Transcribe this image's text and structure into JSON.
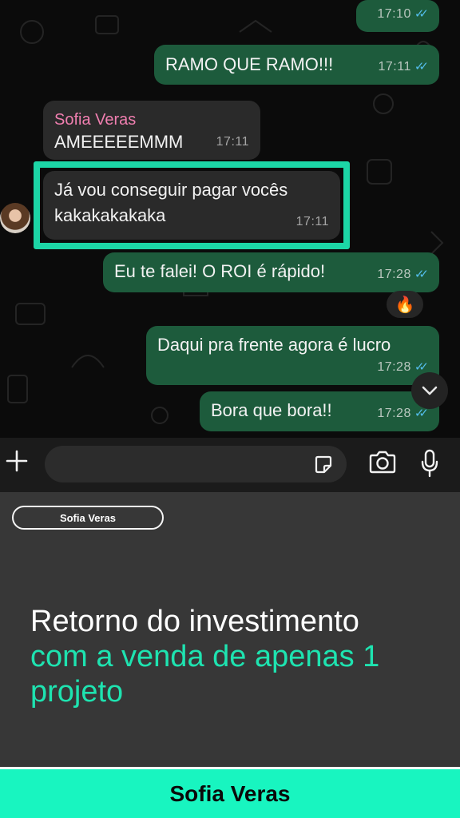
{
  "colors": {
    "outgoing_bubble": "#1d5b3c",
    "incoming_bubble": "#2a2a2a",
    "sender_name": "#f07fb0",
    "read_ticks": "#53bdeb",
    "highlight": "#1cd6a6",
    "accent": "#1ee3b0",
    "footer_bg": "#18f5c0"
  },
  "chat": {
    "messages": [
      {
        "direction": "out",
        "text": "",
        "time": "17:10",
        "read": true
      },
      {
        "direction": "out",
        "text": "RAMO QUE RAMO!!!",
        "time": "17:11",
        "read": true
      },
      {
        "direction": "in",
        "sender": "Sofia Veras",
        "text": "AMEEEEEMMM",
        "time": "17:11"
      },
      {
        "direction": "in",
        "text_line1": "Já vou conseguir pagar vocês",
        "text_line2": "kakakakakaka",
        "time": "17:11",
        "highlighted": true
      },
      {
        "direction": "out",
        "text": "Eu te falei! O ROI é rápido!",
        "time": "17:28",
        "read": true,
        "reaction": "🔥"
      },
      {
        "direction": "out",
        "text": "Daqui pra frente agora é lucro",
        "time": "17:28",
        "read": true
      },
      {
        "direction": "out",
        "text": "Bora que bora!!",
        "time": "17:28",
        "read": true
      }
    ],
    "avatar_icon": "profile-photo",
    "scroll_icon": "chevron-down-icon"
  },
  "input_bar": {
    "message_placeholder": "",
    "icons": [
      "plus-icon",
      "sticker-icon",
      "camera-icon",
      "microphone-icon"
    ]
  },
  "panel": {
    "name_tag": "Sofia Veras",
    "headline_line1": "Retorno do investimento",
    "headline_line2": "com a venda de apenas 1",
    "headline_line3": "projeto"
  },
  "footer": {
    "name": "Sofia Veras"
  }
}
